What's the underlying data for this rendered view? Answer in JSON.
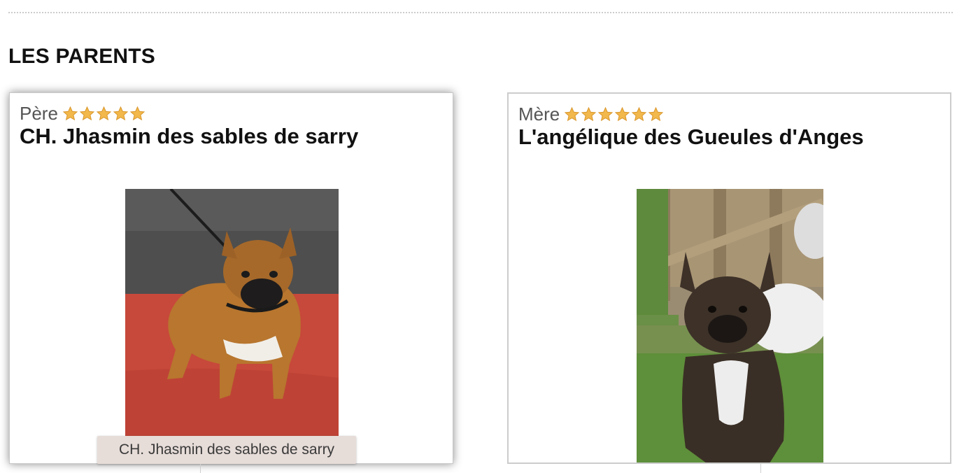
{
  "section": {
    "title": "LES PARENTS"
  },
  "parents": [
    {
      "role": "Père",
      "name": "CH. Jhasmin des sables de sarry",
      "stars": 5,
      "photo_alt": "CH. Jhasmin des sables de sarry"
    },
    {
      "role": "Mère",
      "name": "L'angélique des Gueules d'Anges",
      "stars": 6,
      "photo_alt": "L'angélique des Gueules d'Anges"
    }
  ],
  "tooltip": {
    "text": "CH. Jhasmin des sables de sarry"
  },
  "colors": {
    "star": "#f2b84b",
    "divider": "#cccccc",
    "tooltip_bg": "#e6dcd8"
  },
  "icons": {
    "rating": "star-icon"
  }
}
